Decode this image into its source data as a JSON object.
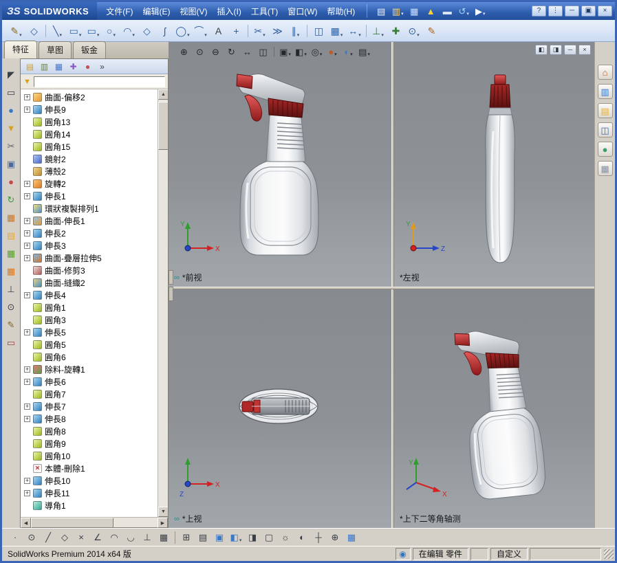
{
  "titlebar": {
    "logo_mark": "ЗS",
    "logo_text": "SOLIDWORKS",
    "menus": [
      {
        "name": "menu-file",
        "label": "文件(F)"
      },
      {
        "name": "menu-edit",
        "label": "编辑(E)"
      },
      {
        "name": "menu-view",
        "label": "视图(V)"
      },
      {
        "name": "menu-insert",
        "label": "插入(I)"
      },
      {
        "name": "menu-tools",
        "label": "工具(T)"
      },
      {
        "name": "menu-window",
        "label": "窗口(W)"
      },
      {
        "name": "menu-help",
        "label": "帮助(H)"
      }
    ],
    "tools": [
      {
        "name": "new-document-icon",
        "glyph": "▤",
        "color": "#eef3fc"
      },
      {
        "name": "open-document-icon",
        "glyph": "▥",
        "color": "#ffd978",
        "dd": true
      },
      {
        "name": "save-icon",
        "glyph": "▦",
        "color": "#cfe0ff"
      },
      {
        "name": "alert-icon",
        "glyph": "▲",
        "color": "#ffd23a"
      },
      {
        "name": "print-icon",
        "glyph": "▬",
        "color": "#dde6f5"
      },
      {
        "name": "undo-icon",
        "glyph": "↺",
        "color": "#9fd4ff",
        "dd": true
      },
      {
        "name": "select-cursor-icon",
        "glyph": "▶",
        "color": "#ffffff",
        "dd": true
      }
    ],
    "controls": [
      {
        "name": "help-icon",
        "glyph": "?"
      },
      {
        "name": "toolbar-options-icon",
        "glyph": "⋮"
      },
      {
        "name": "minimize-button",
        "glyph": "─"
      },
      {
        "name": "restore-button",
        "glyph": "▣"
      },
      {
        "name": "close-button",
        "glyph": "×"
      }
    ]
  },
  "sketch_toolbar": {
    "items": [
      {
        "name": "sketch-icon",
        "glyph": "✎",
        "color": "#8a6a20",
        "dd": true
      },
      {
        "name": "smart-dimension-icon",
        "glyph": "◇",
        "color": "#2e5f9e"
      },
      {
        "sep": true
      },
      {
        "name": "line-icon",
        "glyph": "╲",
        "color": "#2e5f9e",
        "dd": true
      },
      {
        "name": "corner-rectangle-icon",
        "glyph": "▭",
        "color": "#2e5f9e",
        "dd": true
      },
      {
        "name": "straight-slot-icon",
        "glyph": "▭",
        "color": "#2e5f9e",
        "dd": true
      },
      {
        "name": "circle-icon",
        "glyph": "○",
        "color": "#2e5f9e",
        "dd": true
      },
      {
        "name": "arc-icon",
        "glyph": "◠",
        "color": "#2e5f9e",
        "dd": true
      },
      {
        "name": "polygon-icon",
        "glyph": "◇",
        "color": "#2e5f9e"
      },
      {
        "name": "spline-icon",
        "glyph": "ʃ",
        "color": "#2e5f9e"
      },
      {
        "name": "ellipse-icon",
        "glyph": "◯",
        "color": "#2e5f9e",
        "dd": true
      },
      {
        "name": "sketch-fillet-icon",
        "glyph": "⌒",
        "color": "#2e5f9e",
        "dd": true
      },
      {
        "name": "text-icon",
        "glyph": "A",
        "color": "#383e44"
      },
      {
        "name": "point-icon",
        "glyph": "+",
        "color": "#2e5f9e"
      },
      {
        "sep": true
      },
      {
        "name": "trim-entities-icon",
        "glyph": "✂",
        "color": "#2e5f9e",
        "dd": true
      },
      {
        "name": "convert-entities-icon",
        "glyph": "≫",
        "color": "#2e5f9e"
      },
      {
        "name": "offset-entities-icon",
        "glyph": "∥",
        "color": "#2e5f9e",
        "dd": true
      },
      {
        "sep": true
      },
      {
        "name": "mirror-entities-icon",
        "glyph": "◫",
        "color": "#2e5f9e"
      },
      {
        "name": "linear-pattern-icon",
        "glyph": "▦",
        "color": "#2e5f9e",
        "dd": true
      },
      {
        "name": "move-entities-icon",
        "glyph": "↔",
        "color": "#2e5f9e",
        "dd": true
      },
      {
        "sep": true
      },
      {
        "name": "display-relations-icon",
        "glyph": "⊥",
        "color": "#3a7c3a",
        "dd": true
      },
      {
        "name": "repair-sketch-icon",
        "glyph": "✚",
        "color": "#3a7c3a"
      },
      {
        "name": "quick-snaps-icon",
        "glyph": "⊙",
        "color": "#2e5f9e",
        "dd": true
      },
      {
        "name": "rapid-sketch-icon",
        "glyph": "✎",
        "color": "#b06820"
      }
    ]
  },
  "feature_tabs": [
    {
      "name": "tab-features",
      "label": "特征",
      "active": true
    },
    {
      "name": "tab-sketch",
      "label": "草图",
      "active": false
    },
    {
      "name": "tab-sheet-metal",
      "label": "钣金",
      "active": false
    }
  ],
  "fm": {
    "toolbar": [
      {
        "name": "featuremanager-tree-icon",
        "glyph": "▤",
        "color": "#d8a020"
      },
      {
        "name": "propertymanager-icon",
        "glyph": "▥",
        "color": "#6a8a3a"
      },
      {
        "name": "configurationmanager-icon",
        "glyph": "▦",
        "color": "#4a78c8"
      },
      {
        "name": "dimxpertmanager-icon",
        "glyph": "✚",
        "color": "#8a5ac0"
      },
      {
        "name": "displaymanager-icon",
        "glyph": "●",
        "color": "#c85050"
      },
      {
        "name": "tabs-overflow-icon",
        "glyph": "»",
        "color": "#3a4048"
      }
    ],
    "filter_glyph": "▼",
    "filter_value": ""
  },
  "tree": {
    "items": [
      {
        "label": "曲面-偏移2",
        "name": "tree-item-surface-offset-2",
        "c1": "#e8962e",
        "c2": "#f8d888",
        "e": true
      },
      {
        "label": "伸長9",
        "name": "tree-item-extrude-9",
        "c1": "#2f7fc0",
        "c2": "#a8d8f0",
        "e": true
      },
      {
        "label": "圓角13",
        "name": "tree-item-fillet-13",
        "c1": "#9fb918",
        "c2": "#ecf4ae",
        "e": false
      },
      {
        "label": "圓角14",
        "name": "tree-item-fillet-14",
        "c1": "#9fb918",
        "c2": "#ecf4ae",
        "e": false
      },
      {
        "label": "圓角15",
        "name": "tree-item-fillet-15",
        "c1": "#9fb918",
        "c2": "#ecf4ae",
        "e": false
      },
      {
        "label": "鏡射2",
        "name": "tree-item-mirror-2",
        "c1": "#4868c8",
        "c2": "#b0c4f4",
        "e": false
      },
      {
        "label": "薄殼2",
        "name": "tree-item-shell-2",
        "c1": "#c08828",
        "c2": "#f0d890",
        "e": false
      },
      {
        "label": "旋轉2",
        "name": "tree-item-revolve-2",
        "c1": "#e07818",
        "c2": "#f8c880",
        "e": true
      },
      {
        "label": "伸長1",
        "name": "tree-item-extrude-1",
        "c1": "#2f7fc0",
        "c2": "#a8d8f0",
        "e": true
      },
      {
        "label": "環狀複製排列1",
        "name": "tree-item-circular-pattern-1",
        "c1": "#4a90d8",
        "c2": "#f8e070",
        "e": false
      },
      {
        "label": "曲面-伸長1",
        "name": "tree-item-surface-extrude-1",
        "c1": "#e8962e",
        "c2": "#90c8f0",
        "e": true
      },
      {
        "label": "伸長2",
        "name": "tree-item-extrude-2",
        "c1": "#2f7fc0",
        "c2": "#a8d8f0",
        "e": true
      },
      {
        "label": "伸長3",
        "name": "tree-item-extrude-3",
        "c1": "#2f7fc0",
        "c2": "#a8d8f0",
        "e": true
      },
      {
        "label": "曲面-疊層拉伸5",
        "name": "tree-item-surface-loft-5",
        "c1": "#d87828",
        "c2": "#78b8e8",
        "e": true
      },
      {
        "label": "曲面-修剪3",
        "name": "tree-item-surface-trim-3",
        "c1": "#b85858",
        "c2": "#e8e0d8",
        "e": false
      },
      {
        "label": "曲面-縫織2",
        "name": "tree-item-surface-knit-2",
        "c1": "#3f8fca",
        "c2": "#f0d080",
        "e": false
      },
      {
        "label": "伸長4",
        "name": "tree-item-extrude-4",
        "c1": "#2f7fc0",
        "c2": "#a8d8f0",
        "e": true
      },
      {
        "label": "圓角1",
        "name": "tree-item-fillet-1",
        "c1": "#9fb918",
        "c2": "#ecf4ae",
        "e": false
      },
      {
        "label": "圓角3",
        "name": "tree-item-fillet-3",
        "c1": "#9fb918",
        "c2": "#ecf4ae",
        "e": false
      },
      {
        "label": "伸長5",
        "name": "tree-item-extrude-5",
        "c1": "#2f7fc0",
        "c2": "#a8d8f0",
        "e": true
      },
      {
        "label": "圓角5",
        "name": "tree-item-fillet-5",
        "c1": "#9fb918",
        "c2": "#ecf4ae",
        "e": false
      },
      {
        "label": "圓角6",
        "name": "tree-item-fillet-6",
        "c1": "#9fb918",
        "c2": "#ecf4ae",
        "e": false
      },
      {
        "label": "除料-旋轉1",
        "name": "tree-item-cut-revolve-1",
        "c1": "#58a048",
        "c2": "#e87878",
        "e": true
      },
      {
        "label": "伸長6",
        "name": "tree-item-extrude-6",
        "c1": "#2f7fc0",
        "c2": "#a8d8f0",
        "e": true
      },
      {
        "label": "圓角7",
        "name": "tree-item-fillet-7",
        "c1": "#9fb918",
        "c2": "#ecf4ae",
        "e": false
      },
      {
        "label": "伸長7",
        "name": "tree-item-extrude-7",
        "c1": "#2f7fc0",
        "c2": "#a8d8f0",
        "e": true
      },
      {
        "label": "伸長8",
        "name": "tree-item-extrude-8",
        "c1": "#2f7fc0",
        "c2": "#a8d8f0",
        "e": true
      },
      {
        "label": "圓角8",
        "name": "tree-item-fillet-8",
        "c1": "#9fb918",
        "c2": "#ecf4ae",
        "e": false
      },
      {
        "label": "圓角9",
        "name": "tree-item-fillet-9",
        "c1": "#9fb918",
        "c2": "#ecf4ae",
        "e": false
      },
      {
        "label": "圓角10",
        "name": "tree-item-fillet-10",
        "c1": "#9fb918",
        "c2": "#ecf4ae",
        "e": false
      },
      {
        "label": "本體-刪除1",
        "name": "tree-item-delete-body-1",
        "c1": "#ffffff",
        "c2": "#f4e8e8",
        "x": "×",
        "e": false
      },
      {
        "label": "伸長10",
        "name": "tree-item-extrude-10",
        "c1": "#2f7fc0",
        "c2": "#a8d8f0",
        "e": true
      },
      {
        "label": "伸長11",
        "name": "tree-item-extrude-11",
        "c1": "#2f7fc0",
        "c2": "#a8d8f0",
        "e": true
      },
      {
        "label": "導角1",
        "name": "tree-item-chamfer-1",
        "c1": "#30a890",
        "c2": "#b8ece0",
        "e": false
      }
    ]
  },
  "left_toolbar": {
    "items": [
      {
        "name": "select-icon",
        "glyph": "◤",
        "color": "#3a4048"
      },
      {
        "name": "box-select-icon",
        "glyph": "▭",
        "color": "#3a4048"
      },
      {
        "name": "view-orientation-icon",
        "glyph": "●",
        "color": "#3a78c8"
      },
      {
        "name": "selection-filter-icon",
        "glyph": "▼",
        "color": "#d8a020"
      },
      {
        "name": "scissors-icon",
        "glyph": "✂",
        "color": "#5a626a"
      },
      {
        "name": "copy-icon",
        "glyph": "▣",
        "color": "#4a6a9a"
      },
      {
        "name": "appearance-icon",
        "glyph": "●",
        "color": "#c84848"
      },
      {
        "name": "rebuild-icon",
        "glyph": "↻",
        "color": "#3a9a3a"
      },
      {
        "name": "texture-icon",
        "glyph": "▦",
        "color": "#c87828"
      },
      {
        "name": "folder-icon",
        "glyph": "▤",
        "color": "#e8a838"
      },
      {
        "name": "layers-icon",
        "glyph": "▦",
        "color": "#58a028"
      },
      {
        "name": "grid-icon",
        "glyph": "▦",
        "color": "#e07818"
      },
      {
        "name": "axis-icon",
        "glyph": "⊥",
        "color": "#3a4048"
      },
      {
        "name": "pin-icon",
        "glyph": "⊙",
        "color": "#3a4048"
      },
      {
        "name": "pencil-icon",
        "glyph": "✎",
        "color": "#806020"
      },
      {
        "name": "eraser-icon",
        "glyph": "▭",
        "color": "#a04040"
      }
    ]
  },
  "right_panel": {
    "items": [
      {
        "name": "home-icon",
        "glyph": "⌂",
        "color": "#c05818"
      },
      {
        "name": "design-library-icon",
        "glyph": "▥",
        "color": "#3a78c8"
      },
      {
        "name": "file-explorer-icon",
        "glyph": "▤",
        "color": "#e8b030"
      },
      {
        "name": "view-palette-icon",
        "glyph": "◫",
        "color": "#4068b8"
      },
      {
        "name": "appearances-scenes-icon",
        "glyph": "●",
        "color": "#38a068"
      },
      {
        "name": "custom-properties-icon",
        "glyph": "▦",
        "color": "#8890a0"
      }
    ]
  },
  "graphics": {
    "toolbar": [
      {
        "name": "zoom-to-fit-icon",
        "glyph": "⊕"
      },
      {
        "name": "zoom-to-area-icon",
        "glyph": "⊙"
      },
      {
        "name": "zoom-in-out-icon",
        "glyph": "⊖"
      },
      {
        "name": "rotate-view-icon",
        "glyph": "↻"
      },
      {
        "name": "pan-icon",
        "glyph": "↔"
      },
      {
        "name": "section-view-icon",
        "glyph": "◫"
      },
      {
        "sep": true
      },
      {
        "name": "view-orientation-icon",
        "glyph": "▣",
        "dd": true
      },
      {
        "name": "display-style-icon",
        "glyph": "◧",
        "dd": true
      },
      {
        "name": "hide-show-items-icon",
        "glyph": "◎",
        "dd": true
      },
      {
        "name": "edit-appearance-icon",
        "glyph": "●",
        "color": "#c85828",
        "dd": true
      },
      {
        "name": "apply-scene-icon",
        "glyph": "◐",
        "color": "#3a78c8",
        "dd": true
      },
      {
        "name": "view-settings-icon",
        "glyph": "▤",
        "dd": true
      }
    ],
    "pane_controls": [
      {
        "name": "tile-horizontally-icon",
        "glyph": "◧"
      },
      {
        "name": "tile-vertically-icon",
        "glyph": "◨"
      },
      {
        "name": "minimize-pane-icon",
        "glyph": "─"
      },
      {
        "name": "close-pane-icon",
        "glyph": "×"
      }
    ],
    "viewports": [
      {
        "name": "viewport-front",
        "label": "*前视",
        "link_glyph": "∞"
      },
      {
        "name": "viewport-left",
        "label": "*左视"
      },
      {
        "name": "viewport-top",
        "label": "*上视",
        "link_glyph": "∞"
      },
      {
        "name": "viewport-isometric",
        "label": "*上下二等角轴测"
      }
    ],
    "axis": {
      "x": "X",
      "y": "Y",
      "z": "Z"
    }
  },
  "bottom_toolbar": {
    "items": [
      {
        "name": "snap-point-icon",
        "glyph": "·"
      },
      {
        "name": "snap-center-icon",
        "glyph": "⊙"
      },
      {
        "name": "snap-line-icon",
        "glyph": "╱"
      },
      {
        "name": "snap-quadrant-icon",
        "glyph": "◇"
      },
      {
        "name": "snap-intersection-icon",
        "glyph": "×"
      },
      {
        "name": "snap-angle-icon",
        "glyph": "∠"
      },
      {
        "name": "snap-arc-icon",
        "glyph": "◠"
      },
      {
        "name": "snap-tangent-icon",
        "glyph": "◡"
      },
      {
        "name": "snap-perpendicular-icon",
        "glyph": "⊥"
      },
      {
        "name": "snap-grid-icon",
        "glyph": "▦"
      },
      {
        "sep": true
      },
      {
        "name": "grid-settings-icon",
        "glyph": "⊞"
      },
      {
        "name": "dimension-standard-icon",
        "glyph": "▤"
      },
      {
        "name": "view-cube-icon",
        "glyph": "▣",
        "color": "#3a78c8"
      },
      {
        "name": "section-display-icon",
        "glyph": "◧",
        "color": "#3a78c8",
        "dd": true
      },
      {
        "name": "display-planes-icon",
        "glyph": "◨"
      },
      {
        "name": "camera-icon",
        "glyph": "▢"
      },
      {
        "name": "lights-icon",
        "glyph": "☼"
      },
      {
        "name": "shadow-icon",
        "glyph": "◐"
      },
      {
        "name": "axes-icon",
        "glyph": "┼"
      },
      {
        "name": "origin-icon",
        "glyph": "⊕"
      },
      {
        "name": "grid-toggle-icon",
        "glyph": "▦",
        "color": "#3a78c8"
      }
    ]
  },
  "scroll": {
    "up": "▲",
    "down": "▼",
    "left": "◀",
    "right": "▶"
  },
  "statusbar": {
    "left": "SolidWorks Premium 2014 x64 版",
    "cells": [
      {
        "name": "status-note-icon",
        "glyph": "◉",
        "color": "#2878c8",
        "text": ""
      },
      {
        "name": "status-editing",
        "text": "在编辑 零件"
      },
      {
        "name": "status-spacer",
        "text": ""
      },
      {
        "name": "status-custom",
        "text": "自定义"
      },
      {
        "name": "status-right-spacer",
        "text": ""
      }
    ]
  }
}
